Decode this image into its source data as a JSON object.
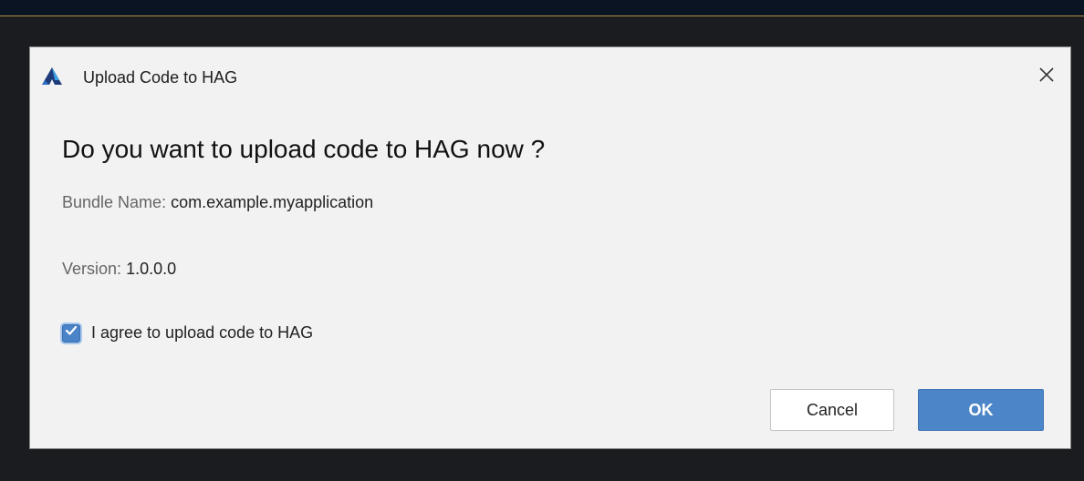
{
  "dialog": {
    "title": "Upload Code to HAG",
    "headline": "Do you want to upload code to HAG now ?",
    "bundle_label": "Bundle Name:",
    "bundle_value": "com.example.myapplication",
    "version_label": "Version:",
    "version_value": "1.0.0.0",
    "agree_label": "I agree to upload code to HAG",
    "agree_checked": true,
    "cancel_label": "Cancel",
    "ok_label": "OK",
    "icons": {
      "app": "app-logo-icon",
      "close": "close-icon",
      "check": "checkmark-icon"
    }
  },
  "colors": {
    "accent": "#4d86c8",
    "dialog_bg": "#f2f2f2",
    "backdrop": "#1b1c1f",
    "logo_dark": "#1d3b78",
    "logo_light": "#3aa0e6"
  }
}
